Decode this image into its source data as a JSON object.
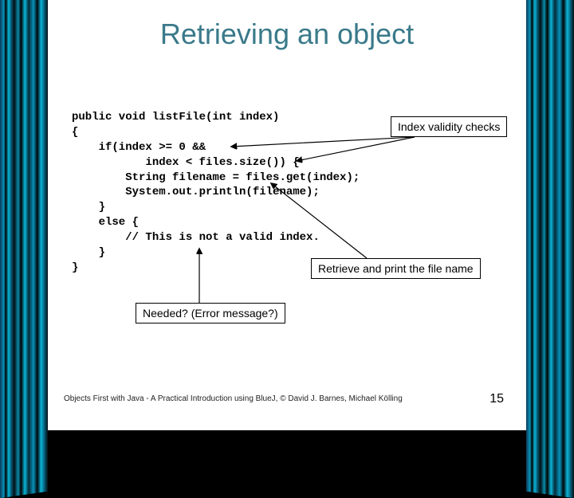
{
  "title": "Retrieving an object",
  "code": {
    "l1": "public void listFile(int index)",
    "l2": "{",
    "l3": "    if(index >= 0 &&",
    "l4": "           index < files.size()) {",
    "l5": "        String filename = files.get(index);",
    "l6": "        System.out.println(filename);",
    "l7": "    }",
    "l8": "    else {",
    "l9": "        // This is not a valid index.",
    "l10": "    }",
    "l11": "}"
  },
  "callouts": {
    "validity": "Index validity checks",
    "retrieve": "Retrieve and print the file name",
    "needed": "Needed? (Error message?)"
  },
  "footer": "Objects First with Java - A Practical Introduction using BlueJ, © David J. Barnes, Michael Kölling",
  "page": "15"
}
